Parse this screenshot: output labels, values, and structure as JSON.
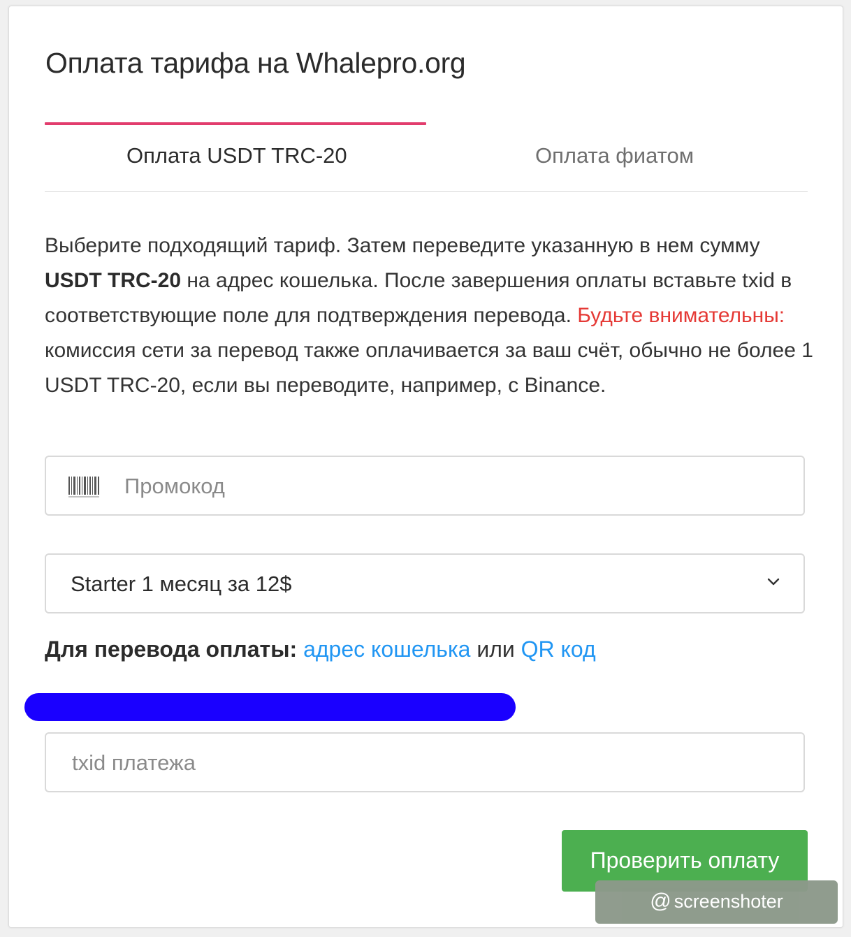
{
  "page": {
    "title": "Оплата тарифа на Whalepro.org"
  },
  "tabs": [
    {
      "label": "Оплата USDT TRC-20",
      "active": true
    },
    {
      "label": "Оплата фиатом",
      "active": false
    }
  ],
  "instructions": {
    "part1": "Выберите подходящий тариф. Затем переведите указанную в нем сумму ",
    "bold": "USDT TRC-20",
    "part2": " на адрес кошелька. После завершения оплаты вставьте txid в соответствующие поле для подтверждения перевода. ",
    "warning": "Будьте внимательны:",
    "part3": " комиссия сети за перевод также оплачивается за ваш счёт, обычно не более 1 USDT TRC-20, если вы переводите, например, с Binance."
  },
  "promo": {
    "placeholder": "Промокод",
    "icon": "barcode-icon"
  },
  "tariff_select": {
    "selected": "Starter 1 месяц за 12$",
    "icon": "chevron-down-icon"
  },
  "transfer": {
    "label": "Для перевода оплаты:",
    "wallet_link": "адрес кошелька",
    "or": "или",
    "qr_link": "QR код"
  },
  "txid": {
    "placeholder": "txid платежа"
  },
  "check_button": {
    "label": "Проверить оплату"
  },
  "watermark": {
    "at": "@",
    "text": "screenshoter"
  },
  "colors": {
    "tab_indicator": "#e23d6d",
    "warning": "#e53935",
    "link": "#2196f3",
    "button": "#4caf50",
    "redaction": "#1a00ff"
  }
}
